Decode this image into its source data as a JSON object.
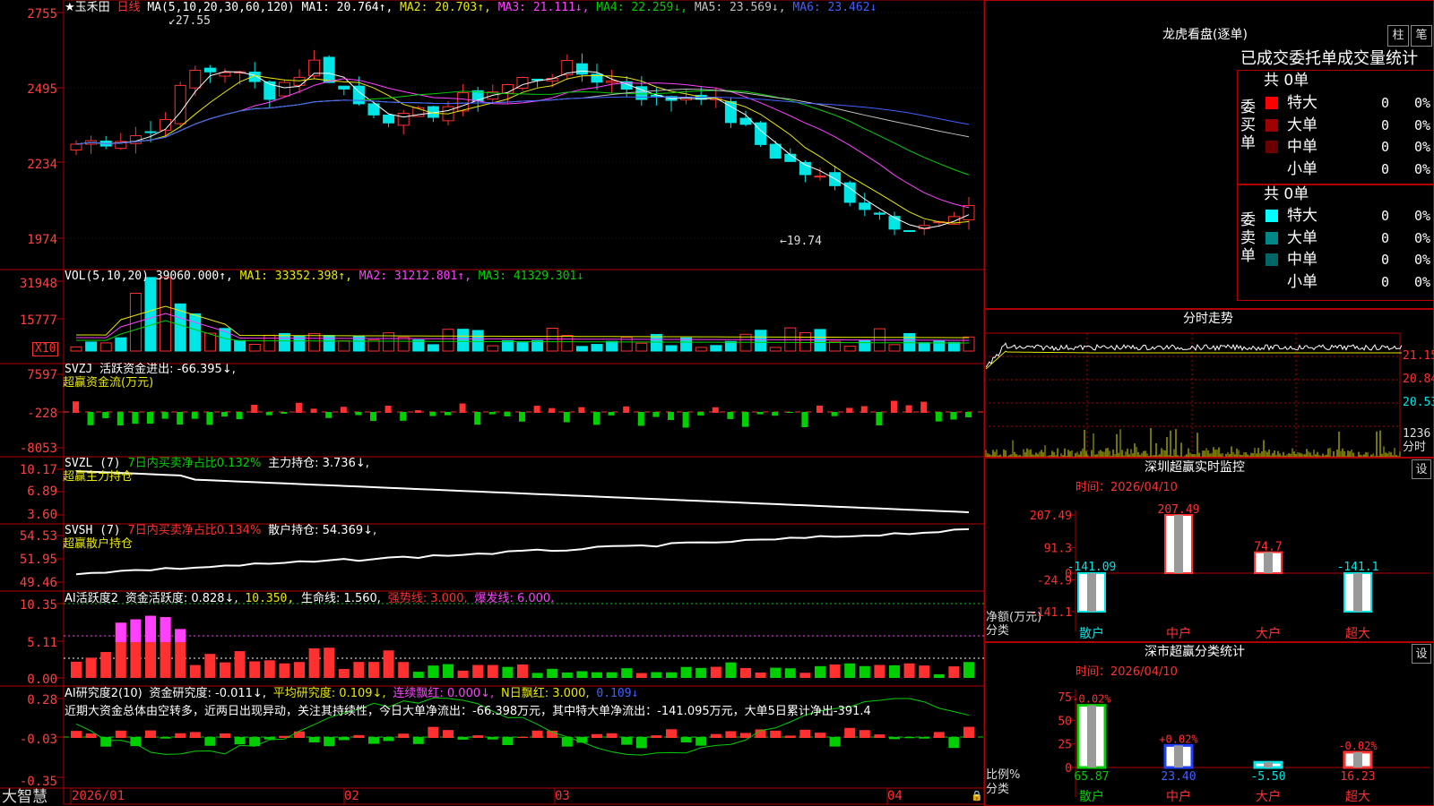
{
  "colors": {
    "up": "#ff3030",
    "down": "#00e5e5",
    "frame": "#b00000",
    "white": "#ffffff",
    "yellow": "#e8e800",
    "magenta": "#ff40ff",
    "green": "#00d000",
    "blue": "#4060ff",
    "gray": "#c0c0c0",
    "red_text": "#ff3030"
  },
  "kline": {
    "title_star": "★玉禾田",
    "period": "日线",
    "ma_label": "MA(5,10,20,30,60,120)",
    "ma1": "MA1: 20.764↑,",
    "ma2": "MA2: 20.703↑,",
    "ma3": "MA3: 21.111↓,",
    "ma4": "MA4: 22.259↓,",
    "ma5": "MA5: 23.569↓,",
    "ma6": "MA6: 23.462↓",
    "high_mark": "27.55",
    "low_mark": "19.74",
    "yticks": [
      "2755",
      "2495",
      "2234",
      "1974"
    ]
  },
  "vol": {
    "label": "VOL(5,10,20)",
    "value": "39060.000↑,",
    "ma1": "MA1: 33352.398↑,",
    "ma2": "MA2: 31212.801↑,",
    "ma3": "MA3: 41329.301↓",
    "yticks": [
      "31948",
      "15777"
    ],
    "unit": "X10"
  },
  "svzj": {
    "label": "SVZJ",
    "desc": "活跃资金进出: -66.395↓,",
    "sub": "超赢资金流(万元)",
    "yticks": [
      "7597",
      "-228",
      "-8053"
    ]
  },
  "svzl": {
    "label": "SVZL (7)",
    "desc": "7日内买卖净占比0.132%",
    "hold": "主力持仓: 3.736↓,",
    "sub": "超赢主力持仓",
    "yticks": [
      "10.17",
      "6.89",
      "3.60"
    ]
  },
  "svsh": {
    "label": "SVSH (7)",
    "desc": "7日内买卖净占比0.134%",
    "hold": "散户持仓: 54.369↓,",
    "sub": "超赢散户持仓",
    "yticks": [
      "54.53",
      "51.95",
      "49.46"
    ]
  },
  "ai1": {
    "label": "AI活跃度2",
    "a": "资金活跃度: 0.828↓,",
    "b": "10.350,",
    "c": "生命线: 1.560,",
    "d": "强势线: 3.000,",
    "e": "爆发线: 6.000,",
    "yticks": [
      "10.35",
      "5.11",
      "0.00"
    ]
  },
  "ai2": {
    "label": "AI研究度2(10)",
    "a": "资金研究度: -0.011↓,",
    "b": "平均研究度: 0.109↓,",
    "c": "连续飘红: 0.000↓,",
    "d": "N日飘红: 3.000,",
    "e": "0.109↓",
    "note": "近期大资金总体由空转多，近两日出现异动，关注其持续性，今日大单净流出：-66.398万元，其中特大单净流出：-141.095万元，大单5日累计净出-391.4",
    "yticks": [
      "0.28",
      "-0.03",
      "-0.35"
    ]
  },
  "dates": [
    "2026/01",
    "02",
    "03",
    "04"
  ],
  "brand": "大智慧",
  "lhb": {
    "title": "龙虎看盘(逐单)",
    "btn1": "柱",
    "btn2": "笔",
    "tabs": "已成交委托单成交量统计",
    "buy_side": "委买单",
    "sell_side": "委卖单",
    "buy_total": "共 0单",
    "sell_total": "共 0单",
    "buy_rows": [
      {
        "name": "特大",
        "n": "0",
        "p": "0%",
        "c": "#ff0000"
      },
      {
        "name": "大单",
        "n": "0",
        "p": "0%",
        "c": "#a00000"
      },
      {
        "name": "中单",
        "n": "0",
        "p": "0%",
        "c": "#6a0000"
      },
      {
        "name": "小单",
        "n": "0",
        "p": "0%",
        "c": "#000000"
      }
    ],
    "sell_rows": [
      {
        "name": "特大",
        "n": "0",
        "p": "0%",
        "c": "#00ffff"
      },
      {
        "name": "大单",
        "n": "0",
        "p": "0%",
        "c": "#008888"
      },
      {
        "name": "中单",
        "n": "0",
        "p": "0%",
        "c": "#006666"
      },
      {
        "name": "小单",
        "n": "0",
        "p": "0%",
        "c": "#000000"
      }
    ]
  },
  "fenshi": {
    "title": "分时走势",
    "yticks": [
      "21.15",
      "20.84",
      "20.53"
    ],
    "vol_label": "1236",
    "unit": "分时"
  },
  "sz": {
    "title": "深圳超赢实时监控",
    "btn": "设",
    "time": "时间：2026/04/10",
    "yticks": [
      "207.49",
      "91.3",
      "0",
      "-24.9",
      "-141.1"
    ],
    "ylabel": "净额(万元)",
    "xlabel": "分类",
    "cats": [
      "散户",
      "中户",
      "大户",
      "超大"
    ],
    "values": [
      -141.09,
      207.49,
      74.7,
      -141.1
    ],
    "value_labels": [
      "-141.09",
      "207.49",
      "74.7",
      "-141.1"
    ]
  },
  "ss": {
    "title": "深市超赢分类统计",
    "btn": "设",
    "time": "时间：2026/04/10",
    "yticks": [
      "75",
      "50",
      "25",
      "0"
    ],
    "ylabel": "比例%",
    "xlabel": "分类",
    "cats": [
      "散户",
      "中户",
      "大户",
      "超大"
    ],
    "values": [
      65.87,
      23.4,
      -5.5,
      16.23
    ],
    "value_labels": [
      "65.87",
      "23.40",
      "-5.50",
      "16.23"
    ],
    "top_labels": [
      "-0.02%",
      "+0.02%",
      "",
      "-0.02%"
    ]
  }
}
